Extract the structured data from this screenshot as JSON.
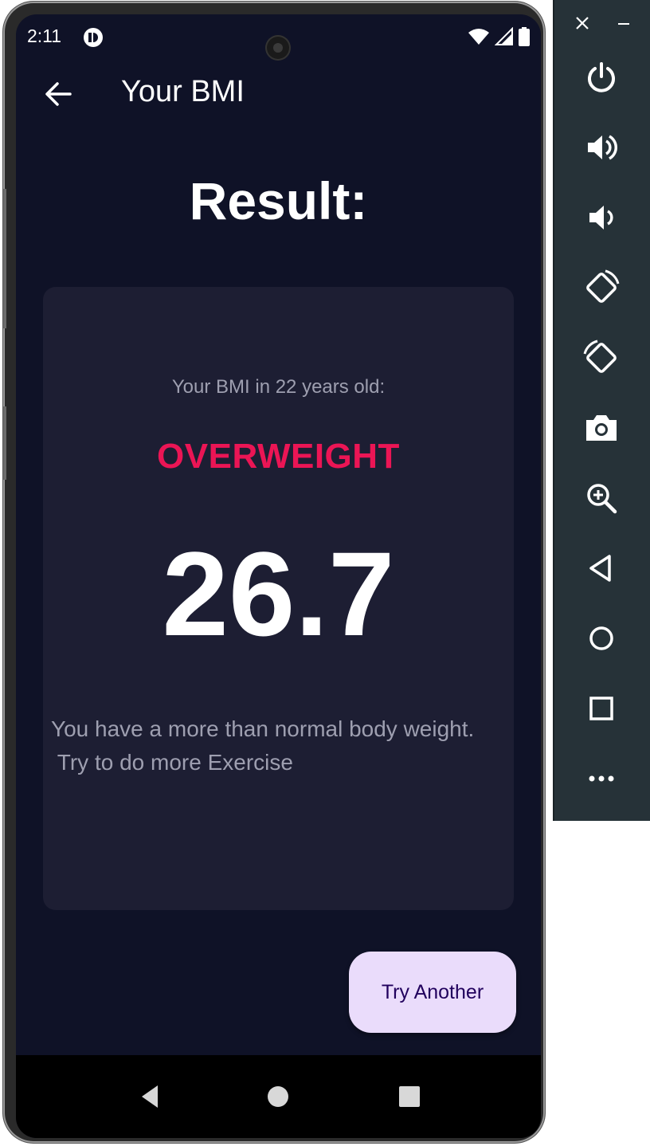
{
  "status_bar": {
    "time": "2:11"
  },
  "app_bar": {
    "title": "Your BMI"
  },
  "result": {
    "heading": "Result:",
    "subtitle": "Your BMI in 22 years old:",
    "status": "OVERWEIGHT",
    "value": "26.7",
    "message": "You have a more than normal body weight.\n Try to do more Exercise"
  },
  "action": {
    "button_label": "Try Another"
  },
  "colors": {
    "background": "#0f1227",
    "card": "#1d1e33",
    "status_accent": "#eb1555",
    "button_bg": "#eadcfb",
    "button_text": "#21005d",
    "toolbar": "#263238"
  },
  "toolbar_icons": [
    "close-icon",
    "minimize-icon",
    "power-icon",
    "volume-up-icon",
    "volume-down-icon",
    "rotate-left-icon",
    "rotate-right-icon",
    "camera-icon",
    "zoom-icon",
    "back-icon",
    "home-icon",
    "overview-icon",
    "more-icon"
  ]
}
